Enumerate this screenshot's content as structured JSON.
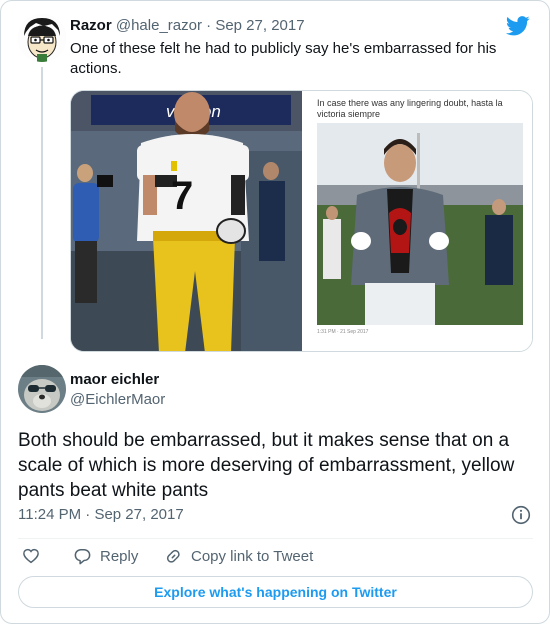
{
  "quoted_tweet": {
    "author_name": "Razor",
    "author_handle": "@hale_razor",
    "separator": "·",
    "date": "Sep 27, 2017",
    "text": "One of these felt he had to publicly say he's embarrassed for his actions.",
    "media": {
      "left_photo_sign": "verizon",
      "right_caption": "In case there was any lingering doubt, hasta la victoria siempre",
      "right_footnote": "1:31 PM · 21 Sep 2017"
    }
  },
  "main_tweet": {
    "author_name": "maor eichler",
    "author_handle": "@EichlerMaor",
    "text": "Both should be embarrassed, but it makes sense that on a scale of which is more deserving of embarrassment, yellow pants beat white pants",
    "time": "11:24 PM",
    "separator": "·",
    "date": "Sep 27, 2017"
  },
  "actions": {
    "like_icon": "heart-icon",
    "reply_label": "Reply",
    "copy_link_label": "Copy link to Tweet"
  },
  "explore_button_label": "Explore what's happening on Twitter",
  "colors": {
    "accent": "#1d9bf0",
    "text_primary": "#0f1419",
    "text_secondary": "#536471",
    "border": "#cfd9de"
  }
}
